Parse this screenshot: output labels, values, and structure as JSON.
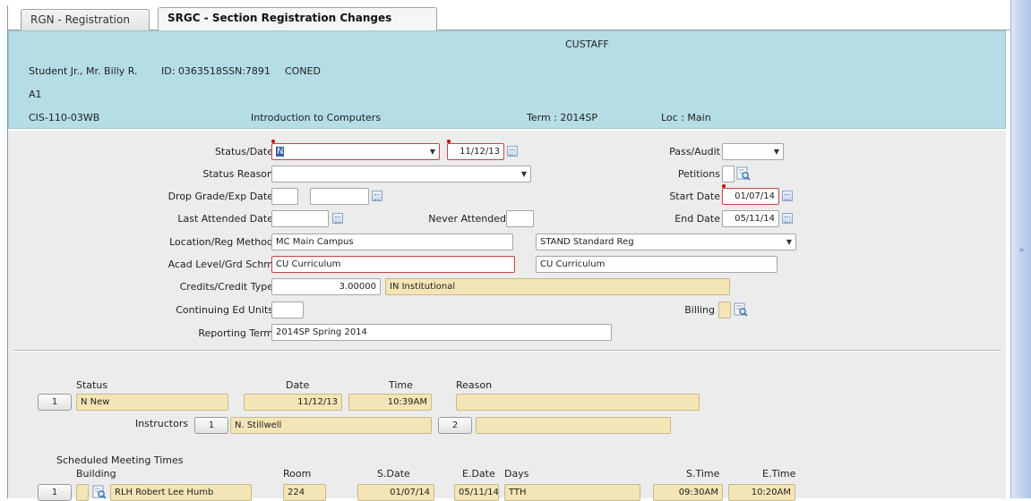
{
  "tabs": [
    {
      "label": "RGN - Registration"
    },
    {
      "label": "SRGC - Section Registration Changes"
    }
  ],
  "header": {
    "user": "CUSTAFF",
    "student_name": "Student Jr., Mr. Billy R.",
    "student_id": "ID: 0363518",
    "ssn": "SSN:7891",
    "program": "CONED",
    "code": "A1",
    "section": "CIS-110-03WB",
    "course_title": "Introduction to Computers",
    "term": "Term :  2014SP",
    "location": "Loc :  Main"
  },
  "form": {
    "status_date_label": "Status/Date",
    "status_value": "N",
    "status_date_value": "11/12/13",
    "status_reason_label": "Status Reason",
    "status_reason_value": "",
    "drop_grade_label": "Drop Grade/Exp Date",
    "drop_grade_value": "",
    "exp_date_value": "",
    "last_attended_label": "Last Attended Date",
    "last_attended_value": "",
    "never_attended_label": "Never Attended",
    "never_attended_value": "",
    "location_label": "Location/Reg Method",
    "location_value": "MC Main Campus",
    "reg_method_value": "STAND Standard Reg",
    "acad_level_label": "Acad Level/Grd Schm",
    "acad_level_value": "CU Curriculum",
    "grd_schm_value": "CU Curriculum",
    "credits_label": "Credits/Credit Type",
    "credits_value": "3.00000",
    "credit_type_value": "IN Institutional",
    "ceu_label": "Continuing Ed Units",
    "ceu_value": "",
    "reporting_term_label": "Reporting Term",
    "reporting_term_value": "2014SP Spring 2014",
    "pass_audit_label": "Pass/Audit",
    "pass_audit_value": "",
    "petitions_label": "Petitions",
    "start_date_label": "Start Date",
    "start_date_value": "01/07/14",
    "end_date_label": "End Date",
    "end_date_value": "05/11/14",
    "billing_label": "Billing"
  },
  "status_grid": {
    "headers": {
      "status": "Status",
      "date": "Date",
      "time": "Time",
      "reason": "Reason"
    },
    "row_number": "1",
    "status": "N New",
    "date": "11/12/13",
    "time": "10:39AM",
    "reason": ""
  },
  "instructors": {
    "label": "Instructors",
    "slot1_number": "1",
    "slot1_name": "N. Stillwell",
    "slot2_number": "2",
    "slot2_name": ""
  },
  "meetings": {
    "title": "Scheduled  Meeting Times",
    "headers": {
      "building": "Building",
      "room": "Room",
      "sdate": "S.Date",
      "edate": "E.Date",
      "days": "Days",
      "stime": "S.Time",
      "etime": "E.Time"
    },
    "row_number": "1",
    "building": "RLH Robert Lee Humb",
    "room": "224",
    "sdate": "01/07/14",
    "edate": "05/11/14",
    "days": "TTH",
    "stime": "09:30AM",
    "etime": "10:20AM"
  },
  "colors": {
    "header_bg": "#b5dde6",
    "form_bg": "#ececec",
    "readonly_field": "#f3e5b5",
    "required_border": "#cc4444"
  },
  "icons": [
    "lookup-icon",
    "calendar-icon",
    "dropdown-arrow-icon"
  ]
}
